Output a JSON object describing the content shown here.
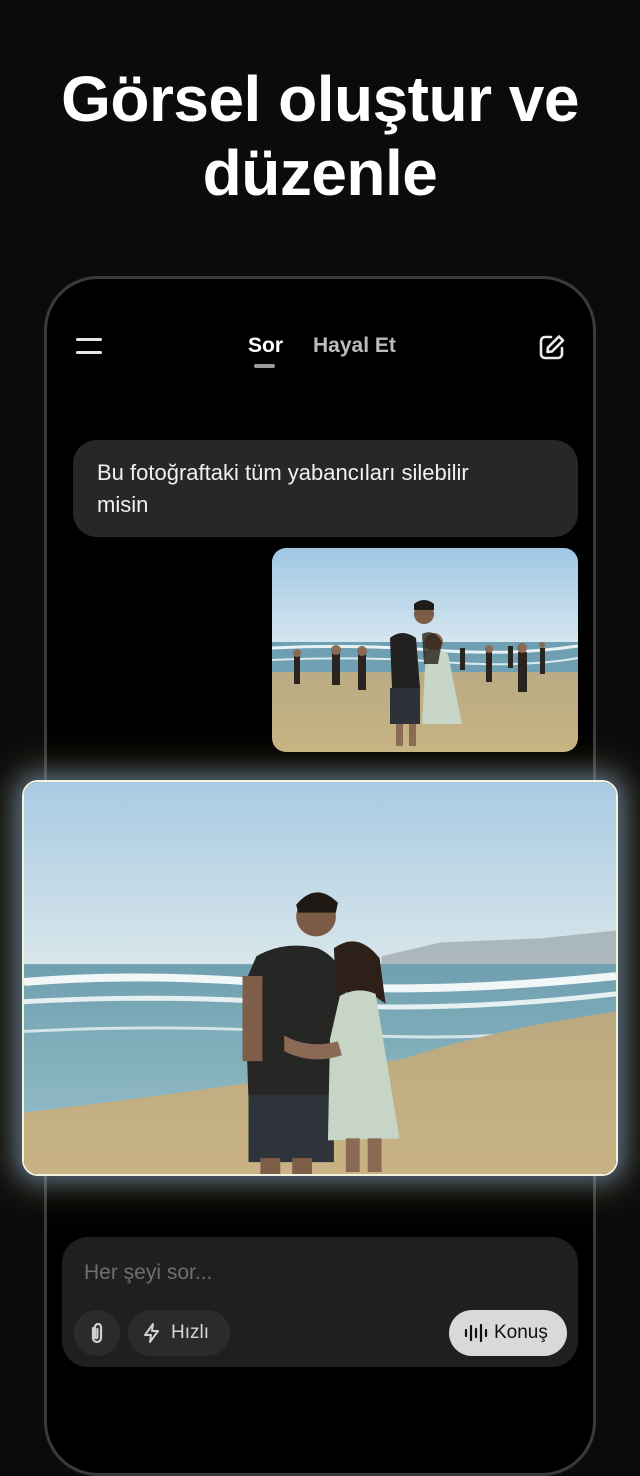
{
  "headline": {
    "line1": "Görsel oluştur ve",
    "line2": "düzenle"
  },
  "header": {
    "tabs": [
      {
        "label": "Sor",
        "active": true
      },
      {
        "label": "Hayal Et",
        "active": false
      }
    ],
    "menu_icon": "hamburger-menu-icon",
    "edit_icon": "new-chat-edit-icon"
  },
  "chat": {
    "user_message_line1": "Bu fotoğraftaki tüm yabancıları silebilir",
    "user_message_line2": "misin",
    "original_image": "beach-photo-with-crowd",
    "edited_image": "beach-photo-couple-only"
  },
  "composer": {
    "placeholder": "Her şeyi sor...",
    "attach_icon": "paperclip-icon",
    "mode_icon": "lightning-icon",
    "mode_label": "Hızlı",
    "voice_icon": "waveform-icon",
    "voice_label": "Konuş"
  },
  "colors": {
    "background": "#0b0b0b",
    "bubble": "#262729",
    "input": "#1f1f21",
    "voice_button": "#d9d9d9"
  }
}
